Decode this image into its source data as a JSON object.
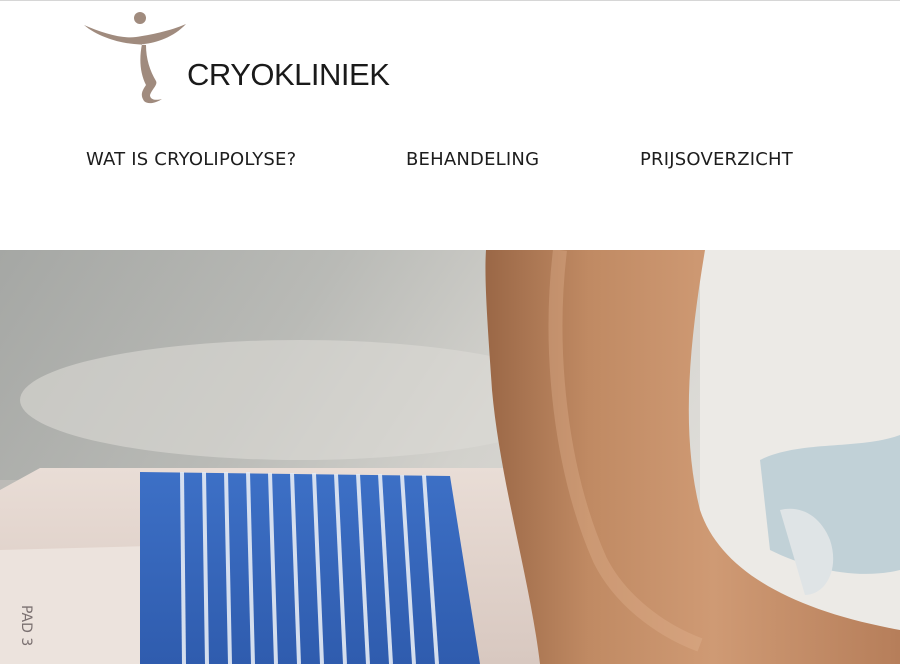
{
  "brand": {
    "name": "CRYOKLINIEK",
    "logo_color": "#a08b7e"
  },
  "nav": {
    "items": [
      {
        "label": "WAT IS CRYOLIPOLYSE?"
      },
      {
        "label": "BEHANDELING"
      },
      {
        "label": "PRIJSOVERZICHT"
      }
    ]
  },
  "hero": {
    "device_label": "PAD 3",
    "strap_color": "#3c6cc2",
    "skin_color": "#c8906b"
  }
}
